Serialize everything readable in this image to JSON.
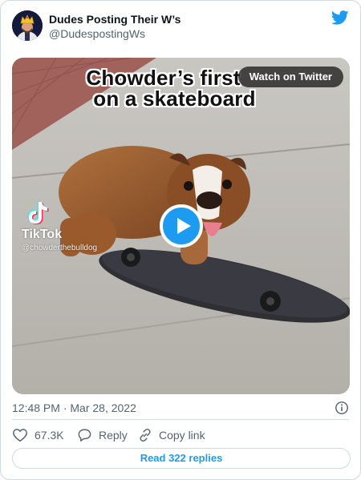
{
  "author": {
    "name": "Dudes Posting Their W’s",
    "handle": "@DudespostingWs",
    "avatar_icon": "crowned-king-avatar",
    "brand_icon": "twitter-bird-icon",
    "brand_color": "#1d9bf0"
  },
  "media": {
    "caption_line1": "Chowder’s first",
    "caption_line2": "on a skateboard",
    "watch_label": "Watch on Twitter",
    "tiktok_label": "TikTok",
    "tiktok_user": "@chowderthebulldog",
    "play_icon": "play-icon"
  },
  "meta": {
    "timestamp": "12:48 PM · Mar 28, 2022",
    "info_icon": "info-icon"
  },
  "actions": {
    "like_count": "67.3K",
    "reply_label": "Reply",
    "copy_label": "Copy link"
  },
  "replies_label": "Read 322 replies"
}
